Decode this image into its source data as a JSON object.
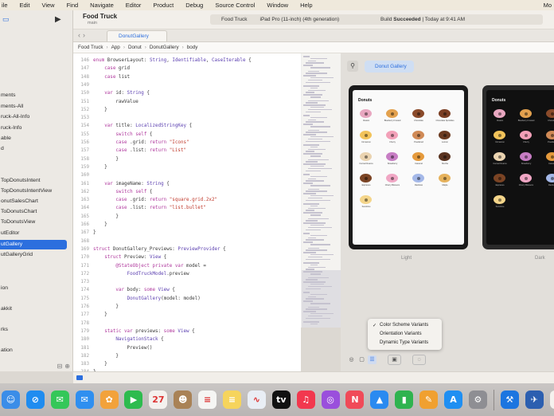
{
  "menubar": {
    "items": [
      "ile",
      "Edit",
      "View",
      "Find",
      "Navigate",
      "Editor",
      "Product",
      "Debug",
      "Source Control",
      "Window",
      "Help"
    ],
    "right_text": "Mo"
  },
  "sidebar": {
    "items": [
      "ments",
      "ments-All",
      "ruck-All-Info",
      "ruck-Info",
      "able",
      "d",
      "TopDonutsIntent",
      "TopDonutsIntentView",
      "onutSalesChart",
      "ToDonutsChart",
      "ToDonutsView",
      "utEditor",
      "utGallery",
      "utGalleryGrid",
      "ion",
      "akkit",
      "rks",
      "ation"
    ],
    "selected_index": 12
  },
  "toolbar": {
    "project_name": "Food Truck",
    "project_sub": "main",
    "scheme": "Food Truck",
    "device": "iPad Pro (11-inch) (4th generation)",
    "status_prefix": "Build",
    "status_word": "Succeeded",
    "status_suffix": "| Today at 9:41 AM"
  },
  "tab": {
    "label": "DonutGallery"
  },
  "jumpbar": [
    "Food Truck",
    "App",
    "Donut",
    "DonutGallery",
    "body"
  ],
  "editor": {
    "lines": [
      {
        "n": "146",
        "t": "enum BrowserLayout: String, Identifiable, CaseIterable {"
      },
      {
        "n": "147",
        "t": "    case grid"
      },
      {
        "n": "148",
        "t": "    case list"
      },
      {
        "n": "149",
        "t": ""
      },
      {
        "n": "150",
        "t": "    var id: String {"
      },
      {
        "n": "151",
        "t": "        rawValue"
      },
      {
        "n": "152",
        "t": "    }"
      },
      {
        "n": "153",
        "t": ""
      },
      {
        "n": "154",
        "t": "    var title: LocalizedStringKey {"
      },
      {
        "n": "155",
        "t": "        switch self {"
      },
      {
        "n": "156",
        "t": "        case .grid: return \"Icons\""
      },
      {
        "n": "157",
        "t": "        case .list: return \"List\""
      },
      {
        "n": "158",
        "t": "        }"
      },
      {
        "n": "159",
        "t": "    }"
      },
      {
        "n": "160",
        "t": ""
      },
      {
        "n": "161",
        "t": "    var imageName: String {"
      },
      {
        "n": "162",
        "t": "        switch self {"
      },
      {
        "n": "163",
        "t": "        case .grid: return \"square.grid.2x2\""
      },
      {
        "n": "164",
        "t": "        case .list: return \"list.bullet\""
      },
      {
        "n": "165",
        "t": "        }"
      },
      {
        "n": "166",
        "t": "    }"
      },
      {
        "n": "167",
        "t": "}"
      },
      {
        "n": "168",
        "t": ""
      },
      {
        "n": "169",
        "t": "struct DonutGallery_Previews: PreviewProvider {"
      },
      {
        "n": "170",
        "t": "    struct Preview: View {"
      },
      {
        "n": "171",
        "t": "        @StateObject private var model ="
      },
      {
        "n": "172",
        "t": "            FoodTruckModel.preview"
      },
      {
        "n": "173",
        "t": ""
      },
      {
        "n": "174",
        "t": "        var body: some View {"
      },
      {
        "n": "175",
        "t": "            DonutGallery(model: model)"
      },
      {
        "n": "176",
        "t": "        }"
      },
      {
        "n": "177",
        "t": "    }"
      },
      {
        "n": "178",
        "t": ""
      },
      {
        "n": "179",
        "t": "    static var previews: some View {"
      },
      {
        "n": "180",
        "t": "        NavigationStack {"
      },
      {
        "n": "181",
        "t": "            Preview()"
      },
      {
        "n": "182",
        "t": "        }"
      },
      {
        "n": "183",
        "t": "    }"
      },
      {
        "n": "184",
        "t": "}"
      },
      {
        "n": "185",
        "t": ""
      }
    ]
  },
  "canvas": {
    "chip_label": "Donut Gallery",
    "light_caption": "Light",
    "dark_caption": "Dark",
    "preview_title": "Donuts",
    "donut_colors": [
      "#e8a7c0",
      "#e3a14e",
      "#8a4a2a",
      "#7a3d22",
      "#f2c35a",
      "#f2a0b8",
      "#d08a56",
      "#6b3a20",
      "#ead3b0",
      "#c77dc4",
      "#e59a3c",
      "#5a3320",
      "#7b4424",
      "#f0a6c4",
      "#a4b8e8",
      "#e6b25c",
      "#f4d58a"
    ],
    "donut_labels": [
      "Classic",
      "Blueberry Frosted",
      "Chocolate",
      "Chocolate Sprinkles",
      "Cinnamon",
      "Cherry",
      "Powdered",
      "Lemon",
      "Cocoa Dreams",
      "Strawberry",
      "Caramel",
      "Mocha",
      "Espresso",
      "Cherry Blossom",
      "Rainbow",
      "Maple",
      "Sunshine"
    ]
  },
  "variants_menu": {
    "options": [
      "Color Scheme Variants",
      "Orientation Variants",
      "Dynamic Type Variants"
    ],
    "checked_index": 0
  },
  "dock": {
    "icons": [
      {
        "name": "finder-icon",
        "color": "#3b8de8",
        "glyph": "☺"
      },
      {
        "name": "safari-icon",
        "color": "#1f8cf0",
        "glyph": "⊘"
      },
      {
        "name": "messages-icon",
        "color": "#34c759",
        "glyph": "✉"
      },
      {
        "name": "mail-icon",
        "color": "#2f8ff0",
        "glyph": "✉"
      },
      {
        "name": "photos-icon",
        "color": "#f2a23b",
        "glyph": "✿"
      },
      {
        "name": "facetime-icon",
        "color": "#2dbb4e",
        "glyph": "▶"
      },
      {
        "name": "calendar-icon",
        "color": "#f4f1ee",
        "glyph": "27"
      },
      {
        "name": "contacts-icon",
        "color": "#a98256",
        "glyph": "☻"
      },
      {
        "name": "reminders-icon",
        "color": "#f5f5f3",
        "glyph": "≡"
      },
      {
        "name": "notes-icon",
        "color": "#f6d45c",
        "glyph": "≡"
      },
      {
        "name": "freeform-icon",
        "color": "#e9eef5",
        "glyph": "∿"
      },
      {
        "name": "appletv-icon",
        "color": "#111111",
        "glyph": "tv"
      },
      {
        "name": "music-icon",
        "color": "#f2384e",
        "glyph": "♫"
      },
      {
        "name": "podcasts-icon",
        "color": "#9a4fdc",
        "glyph": "◎"
      },
      {
        "name": "news-icon",
        "color": "#f04a58",
        "glyph": "N"
      },
      {
        "name": "keynote-icon",
        "color": "#2a8af0",
        "glyph": "▲"
      },
      {
        "name": "numbers-icon",
        "color": "#2fb34f",
        "glyph": "▮"
      },
      {
        "name": "pages-icon",
        "color": "#f0a030",
        "glyph": "✎"
      },
      {
        "name": "appstore-icon",
        "color": "#1f8ff2",
        "glyph": "A"
      },
      {
        "name": "settings-icon",
        "color": "#8e8e93",
        "glyph": "⚙"
      },
      {
        "name": "xcode-icon",
        "color": "#1c75e0",
        "glyph": "⚒"
      },
      {
        "name": "simulator-icon",
        "color": "#2c5fb0",
        "glyph": "✈"
      },
      {
        "name": "folder-icon",
        "color": "#f4f1ee",
        "glyph": "▭"
      }
    ]
  }
}
